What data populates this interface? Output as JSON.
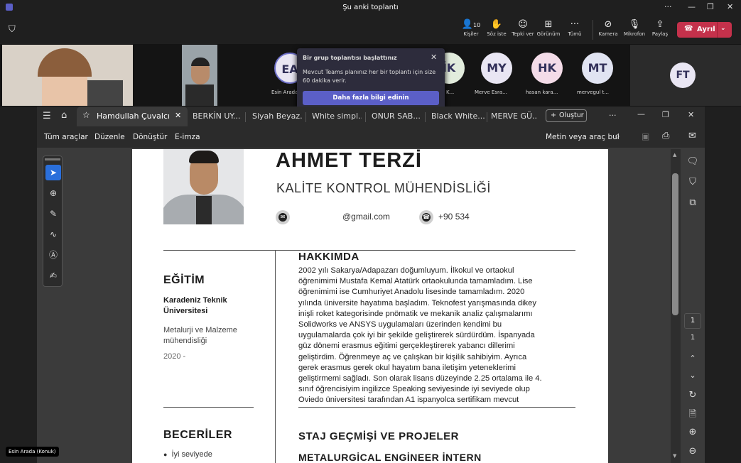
{
  "window": {
    "title": "Şu anki toplantı"
  },
  "toolbar": {
    "people_count": "10",
    "people": "Kişiler",
    "raise": "Söz iste",
    "react": "Tepki ver",
    "view": "Görünüm",
    "more": "Tümü",
    "camera": "Kamera",
    "mic": "Mikrofon",
    "share": "Paylaş",
    "leave": "Ayrıl"
  },
  "participants": {
    "ea_initials": "EA",
    "ea_name": "Esin Arada",
    "ik_initials": "İK",
    "ik_name": "K...",
    "my_initials": "MY",
    "my_name": "Merve Esra...",
    "hk_initials": "HK",
    "hk_name": "hasan kara...",
    "mt_initials": "MT",
    "mt_name": "mervegul t...",
    "ft_initials": "FT"
  },
  "popup": {
    "title": "Bir grup toplantısı başlattınız",
    "body": "Mevcut Teams planınız her bir toplantı için size 60 dakika verir.",
    "button": "Daha fazla bilgi edinin"
  },
  "tabs": {
    "0": "Hamdullah Çuvalcı",
    "1": "BERKİN UY...",
    "2": "Siyah Beyaz...",
    "3": "White simpl...",
    "4": "ONUR SAB...",
    "5": "Black White...",
    "6": "MERVE GÜ...",
    "create": "Oluştur"
  },
  "menubar": {
    "all_tools": "Tüm araçlar",
    "edit": "Düzenle",
    "convert": "Dönüştür",
    "esign": "E-imza",
    "search": "Metin veya araç bul"
  },
  "resume": {
    "name": "AHMET TERZİ",
    "title": "KALİTE KONTROL MÜHENDİSLİĞİ",
    "email": "@gmail.com",
    "phone": "+90 534",
    "education": {
      "heading": "EĞİTİM",
      "school": "Karadeniz Teknik Üniversitesi",
      "department": "Metalurji ve Malzeme mühendisliği",
      "year": "2020 -"
    },
    "skills": {
      "heading": "BECERİLER",
      "item1": "İyi seviyede"
    },
    "about": {
      "heading": "HAKKIMDA",
      "lines": [
        "2002 yılı Sakarya/Adapazarı doğumluyum. İlkokul ve ortaokul",
        "öğrenimimi Mustafa Kemal Atatürk ortaokulunda tamamladım. Lise",
        "öğrenimimi ise Cumhuriyet Anadolu lisesinde tamamladım. 2020",
        "yılında üniversite hayatıma başladım. Teknofest yarışmasında dikey",
        "inişli roket kategorisinde pnömatik ve mekanik analiz çalışmalarımı",
        "Solidworks ve ANSYS uygulamaları üzerinden kendimi bu",
        "uygulamalarda çok iyi bir şekilde geliştirerek sürdürdüm. İspanyada",
        "güz dönemi erasmus eğitimi gerçekleştirerek yabancı dillerimi",
        "geliştirdim. Öğrenmeye aç ve çalışkan bir kişilik sahibiyim. Ayrıca",
        "gerek erasmus gerek okul hayatım bana iletişim yeteneklerimi",
        "geliştirmemi sağladı. Son olarak lisans düzeyinde 2.25 ortalama ile 4.",
        "sınıf öğrencisiyim ingilizce Speaking seviyesinde iyi seviyede olup",
        "Oviedo üniversitesi tarafından A1 ispanyolca sertifikam mevcut"
      ]
    },
    "experience": {
      "heading": "STAJ GEÇMİŞİ VE PROJELER",
      "role": "METALURGİCAL ENGİNEER İNTERN"
    }
  },
  "pager": {
    "current": "1",
    "total": "1"
  },
  "presenter": {
    "label": "Esin Arada (Konuk)"
  }
}
